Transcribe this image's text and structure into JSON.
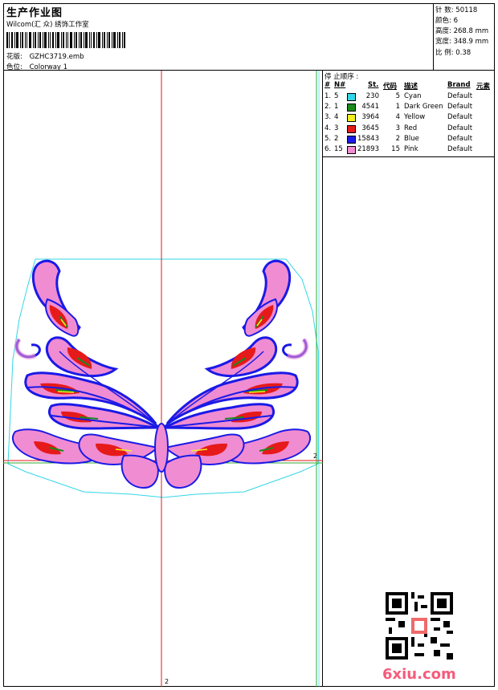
{
  "header": {
    "title": "生产作业图",
    "company": "Wilcom(汇 众) 绣饰工作室",
    "design_label": "花版:",
    "design_file": "GZHC3719.emb",
    "colorway_label": "色位:",
    "colorway": "Colorway 1"
  },
  "info": [
    {
      "label": "针 数:",
      "value": "50118"
    },
    {
      "label": "颜色:",
      "value": "6"
    },
    {
      "label": "高度:",
      "value": "268.8 mm"
    },
    {
      "label": "宽度:",
      "value": "348.9 mm"
    },
    {
      "label": "比 例:",
      "value": "0.38"
    }
  ],
  "stop_sequence": {
    "title": "停 止顺序 :",
    "headers": {
      "num": "#",
      "n": "N#",
      "st": "St.",
      "code": "代码",
      "desc": "描述",
      "brand": "Brand",
      "element": "元素"
    },
    "rows": [
      {
        "idx": "1.",
        "n": "5",
        "color": "#33d6e6",
        "st": "230",
        "code": "5",
        "desc": "Cyan",
        "brand": "Default"
      },
      {
        "idx": "2.",
        "n": "1",
        "color": "#1a8a1a",
        "st": "4541",
        "code": "1",
        "desc": "Dark Green",
        "brand": "Default"
      },
      {
        "idx": "3.",
        "n": "4",
        "color": "#f0f020",
        "st": "3964",
        "code": "4",
        "desc": "Yellow",
        "brand": "Default"
      },
      {
        "idx": "4.",
        "n": "3",
        "color": "#e61a1a",
        "st": "3645",
        "code": "3",
        "desc": "Red",
        "brand": "Default"
      },
      {
        "idx": "5.",
        "n": "2",
        "color": "#1a1ae6",
        "st": "15843",
        "code": "2",
        "desc": "Blue",
        "brand": "Default"
      },
      {
        "idx": "6.",
        "n": "15",
        "color": "#f08cd2",
        "st": "21893",
        "code": "15",
        "desc": "Pink",
        "brand": "Default"
      }
    ]
  },
  "canvas": {
    "axis_label_bottom": "2",
    "axis_label_right": "2"
  },
  "watermark": "6xiu.com"
}
